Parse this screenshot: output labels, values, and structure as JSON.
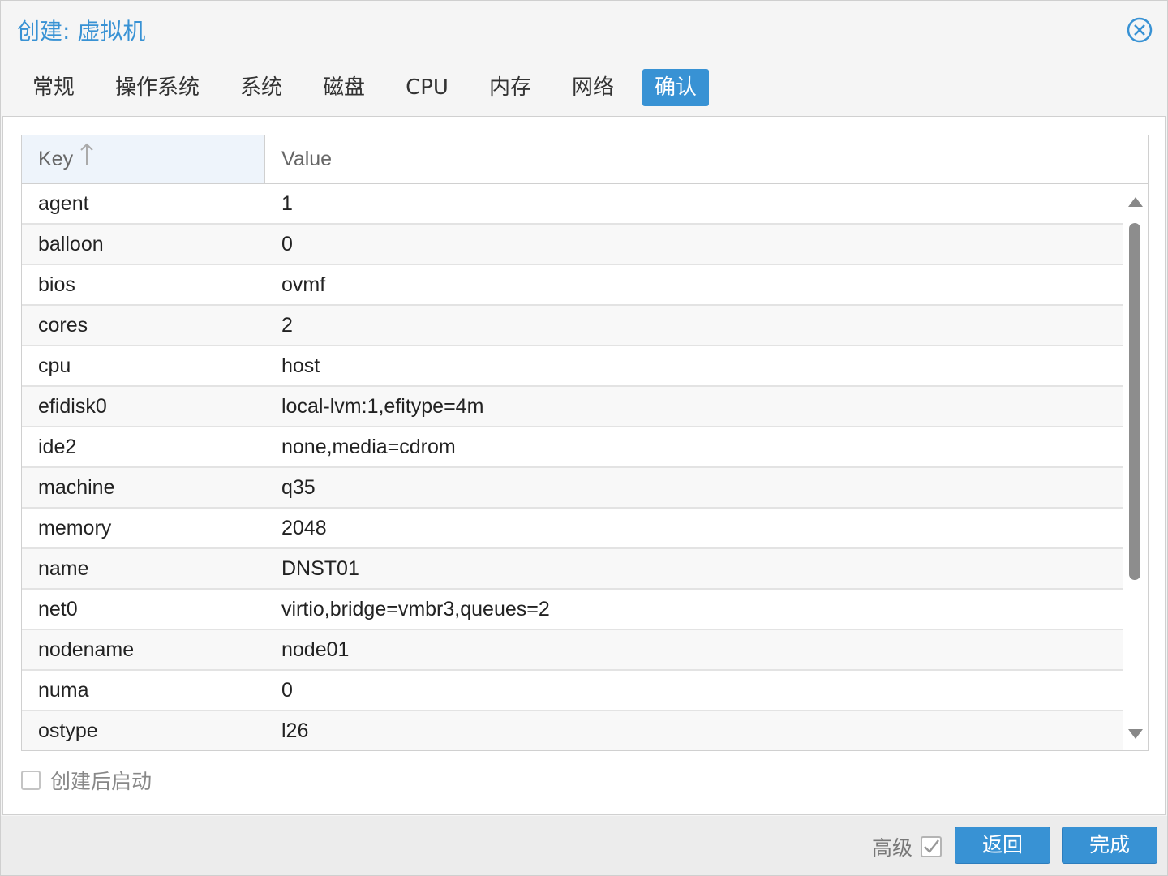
{
  "window": {
    "title": "创建: 虚拟机"
  },
  "tabs": [
    {
      "label": "常规",
      "active": false
    },
    {
      "label": "操作系统",
      "active": false
    },
    {
      "label": "系统",
      "active": false
    },
    {
      "label": "磁盘",
      "active": false
    },
    {
      "label": "CPU",
      "active": false
    },
    {
      "label": "内存",
      "active": false
    },
    {
      "label": "网络",
      "active": false
    },
    {
      "label": "确认",
      "active": true
    }
  ],
  "grid": {
    "columns": {
      "key": "Key",
      "value": "Value"
    },
    "sort": {
      "column": "Key",
      "direction": "ascending",
      "icon": "arrow-up-icon"
    },
    "rows": [
      {
        "key": "agent",
        "value": "1"
      },
      {
        "key": "balloon",
        "value": "0"
      },
      {
        "key": "bios",
        "value": "ovmf"
      },
      {
        "key": "cores",
        "value": "2"
      },
      {
        "key": "cpu",
        "value": "host"
      },
      {
        "key": "efidisk0",
        "value": "local-lvm:1,efitype=4m"
      },
      {
        "key": "ide2",
        "value": "none,media=cdrom"
      },
      {
        "key": "machine",
        "value": "q35"
      },
      {
        "key": "memory",
        "value": "2048"
      },
      {
        "key": "name",
        "value": "DNST01"
      },
      {
        "key": "net0",
        "value": "virtio,bridge=vmbr3,queues=2"
      },
      {
        "key": "nodename",
        "value": "node01"
      },
      {
        "key": "numa",
        "value": "0"
      },
      {
        "key": "ostype",
        "value": "l26"
      }
    ]
  },
  "start_after_create": {
    "label": "创建后启动",
    "checked": false
  },
  "footer": {
    "advanced_label": "高级",
    "advanced_checked": true,
    "back_label": "返回",
    "finish_label": "完成"
  },
  "colors": {
    "accent": "#3892d4",
    "header_sorted_bg": "#eef4fb"
  }
}
